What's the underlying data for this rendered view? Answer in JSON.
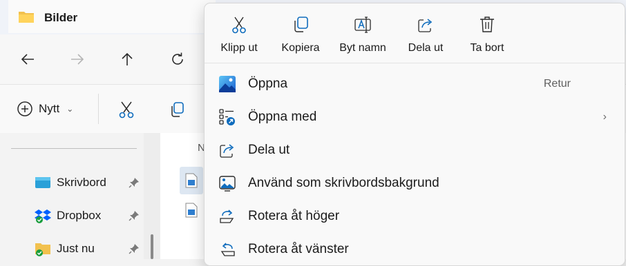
{
  "window": {
    "title": "Bilder",
    "folder_icon": "folder-icon"
  },
  "nav": {
    "back": "arrow-left-icon",
    "forward": "arrow-right-icon",
    "up": "arrow-up-icon",
    "refresh": "refresh-icon"
  },
  "command_bar": {
    "new_label": "Nytt",
    "new_chevron": "⌄"
  },
  "sidebar": {
    "items": [
      {
        "label": "Skrivbord",
        "icon": "desktop-icon"
      },
      {
        "label": "Dropbox",
        "icon": "dropbox-icon"
      },
      {
        "label": "Just nu",
        "icon": "folder-sync-icon"
      }
    ]
  },
  "content": {
    "column_header_partial": "N"
  },
  "context_menu": {
    "quick_actions": [
      {
        "label": "Klipp ut",
        "icon": "scissors-icon"
      },
      {
        "label": "Kopiera",
        "icon": "copy-icon"
      },
      {
        "label": "Byt namn",
        "icon": "rename-icon"
      },
      {
        "label": "Dela ut",
        "icon": "share-icon"
      },
      {
        "label": "Ta bort",
        "icon": "trash-icon"
      }
    ],
    "items": [
      {
        "label": "Öppna",
        "accelerator": "Retur",
        "icon": "image-app-icon"
      },
      {
        "label": "Öppna med",
        "submenu_arrow": "›",
        "icon": "open-with-icon"
      },
      {
        "label": "Dela ut",
        "icon": "share-icon"
      },
      {
        "label": "Använd som skrivbordsbakgrund",
        "icon": "wallpaper-icon"
      },
      {
        "label": "Rotera åt höger",
        "icon": "rotate-right-icon"
      },
      {
        "label": "Rotera åt vänster",
        "icon": "rotate-left-icon"
      }
    ]
  },
  "colors": {
    "accent": "#0f6cbd",
    "menu_bg": "#f9f9f9",
    "folder": "#f2c14e"
  }
}
